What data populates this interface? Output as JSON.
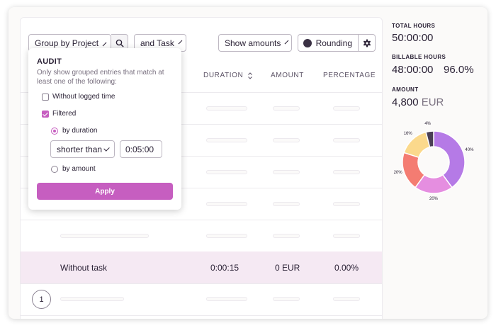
{
  "toolbar": {
    "group_by_label": "Group by Project",
    "and_task_label": "and Task",
    "show_amounts_label": "Show amounts",
    "rounding_label": "Rounding"
  },
  "table": {
    "columns": [
      "DURATION",
      "AMOUNT",
      "PERCENTAGE"
    ],
    "highlight_row": {
      "name": "Without task",
      "duration": "0:00:15",
      "amount": "0 EUR",
      "percentage": "0.00%"
    },
    "row_number": "1"
  },
  "audit_popover": {
    "title": "AUDIT",
    "description": "Only show grouped entries that match at least one of the following:",
    "without_logged_time": {
      "label": "Without logged time",
      "checked": false
    },
    "filtered": {
      "label": "Filtered",
      "checked": true
    },
    "by_duration_label": "by duration",
    "comparison": "shorter than",
    "duration_value": "0:05:00",
    "by_amount_label": "by amount",
    "selected_mode": "by duration",
    "apply_label": "Apply"
  },
  "summary": {
    "total_hours_label": "TOTAL HOURS",
    "total_hours": "50:00:00",
    "billable_hours_label": "BILLABLE HOURS",
    "billable_hours": "48:00:00",
    "billable_percent": "96.0%",
    "amount_label": "AMOUNT",
    "amount": "4,800",
    "currency": "EUR"
  },
  "chart_data": {
    "type": "pie",
    "donut": true,
    "categories": [
      "",
      "",
      "",
      "",
      ""
    ],
    "values": [
      40,
      20,
      20,
      16,
      4
    ],
    "labels": [
      "40%",
      "20%",
      "20%",
      "16%",
      "4%"
    ],
    "colors": [
      "#b57ae6",
      "#e58ee0",
      "#f47c72",
      "#fbd98c",
      "#4a3f55"
    ]
  },
  "colors": {
    "accent": "#c65ec0",
    "highlight_row": "#f5e9f3"
  }
}
